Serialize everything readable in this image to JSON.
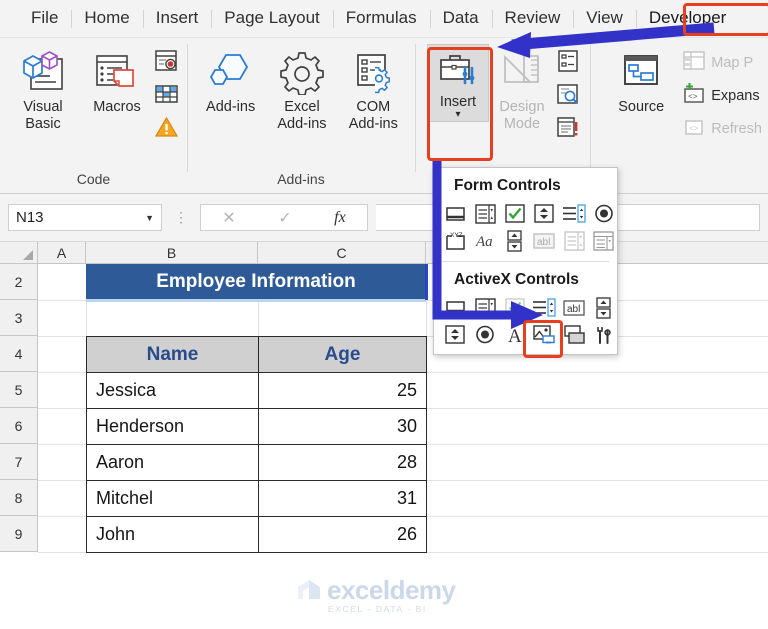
{
  "tabs": [
    {
      "label": "File"
    },
    {
      "label": "Home"
    },
    {
      "label": "Insert"
    },
    {
      "label": "Page Layout"
    },
    {
      "label": "Formulas"
    },
    {
      "label": "Data"
    },
    {
      "label": "Review"
    },
    {
      "label": "View"
    },
    {
      "label": "Developer"
    }
  ],
  "ribbon": {
    "groups": [
      {
        "label": "Code",
        "buttons": [
          {
            "label": "Visual Basic",
            "icon": "visual-basic-icon"
          },
          {
            "label": "Macros",
            "icon": "macros-icon"
          }
        ],
        "small": [
          {
            "label": "",
            "icon": "record-macro-icon"
          },
          {
            "label": "",
            "icon": "use-relative-references-icon"
          },
          {
            "label": "",
            "icon": "macro-security-icon"
          }
        ]
      },
      {
        "label": "Add-ins",
        "buttons": [
          {
            "label": "Add-ins",
            "icon": "addins-icon"
          },
          {
            "label": "Excel Add-ins",
            "icon": "excel-addins-icon"
          },
          {
            "label": "COM Add-ins",
            "icon": "com-addins-icon"
          }
        ]
      },
      {
        "label": "",
        "buttons": [
          {
            "label": "Insert",
            "icon": "insert-controls-icon"
          },
          {
            "label": "Design Mode",
            "icon": "design-mode-icon"
          }
        ],
        "small": [
          {
            "label": "",
            "icon": "properties-icon"
          },
          {
            "label": "",
            "icon": "view-code-icon"
          },
          {
            "label": "",
            "icon": "run-dialog-icon"
          }
        ]
      },
      {
        "label": "",
        "buttons": [
          {
            "label": "Source",
            "icon": "xml-source-icon"
          }
        ],
        "small": [
          {
            "label": "Map P",
            "icon": "map-properties-icon"
          },
          {
            "label": "Expans",
            "icon": "expansion-packs-icon"
          },
          {
            "label": "Refresh",
            "icon": "refresh-data-icon"
          }
        ]
      }
    ]
  },
  "formula_bar": {
    "name_box_value": "N13",
    "formula_value": "",
    "cancel_icon": "cancel-icon",
    "enter_icon": "enter-icon",
    "fx_label": "fx"
  },
  "grid": {
    "column_headers": [
      "A",
      "B",
      "C"
    ],
    "row_headers": [
      "2",
      "3",
      "4",
      "5",
      "6",
      "7",
      "8",
      "9"
    ],
    "title_cell": "Employee Information",
    "table": {
      "headers": [
        "Name",
        "Age"
      ],
      "rows": [
        [
          "Jessica",
          "25"
        ],
        [
          "Henderson",
          "30"
        ],
        [
          "Aaron",
          "28"
        ],
        [
          "Mitchel",
          "31"
        ],
        [
          "John",
          "26"
        ]
      ]
    }
  },
  "dropdown": {
    "form_controls_title": "Form Controls",
    "activex_controls_title": "ActiveX Controls",
    "form_controls_row1": [
      "button-icon",
      "combo-box-icon",
      "check-box-icon",
      "spin-button-icon",
      "list-box-icon",
      "option-button-icon"
    ],
    "form_controls_row2": [
      "group-box-icon",
      "label-icon",
      "scroll-bar-icon",
      "text-field-icon",
      "combo-list-edit-icon",
      "combo-drop-down-edit-icon"
    ],
    "activex_row1": [
      "command-button-icon",
      "combo-box-icon",
      "check-box-icon",
      "list-box-icon",
      "text-box-icon",
      "scroll-bar-icon"
    ],
    "activex_row2": [
      "spin-button-icon",
      "option-button-icon",
      "label-icon",
      "image-icon",
      "toggle-button-icon",
      "more-controls-icon"
    ]
  },
  "watermark": {
    "name": "exceldemy",
    "tagline": "EXCEL - DATA - BI"
  },
  "colors": {
    "highlight_red": "#e8401f",
    "arrow_blue": "#3232c8",
    "title_blue": "#2e5b97",
    "header_gray": "#d0d0d0",
    "header_text_blue": "#2a4b8d"
  }
}
